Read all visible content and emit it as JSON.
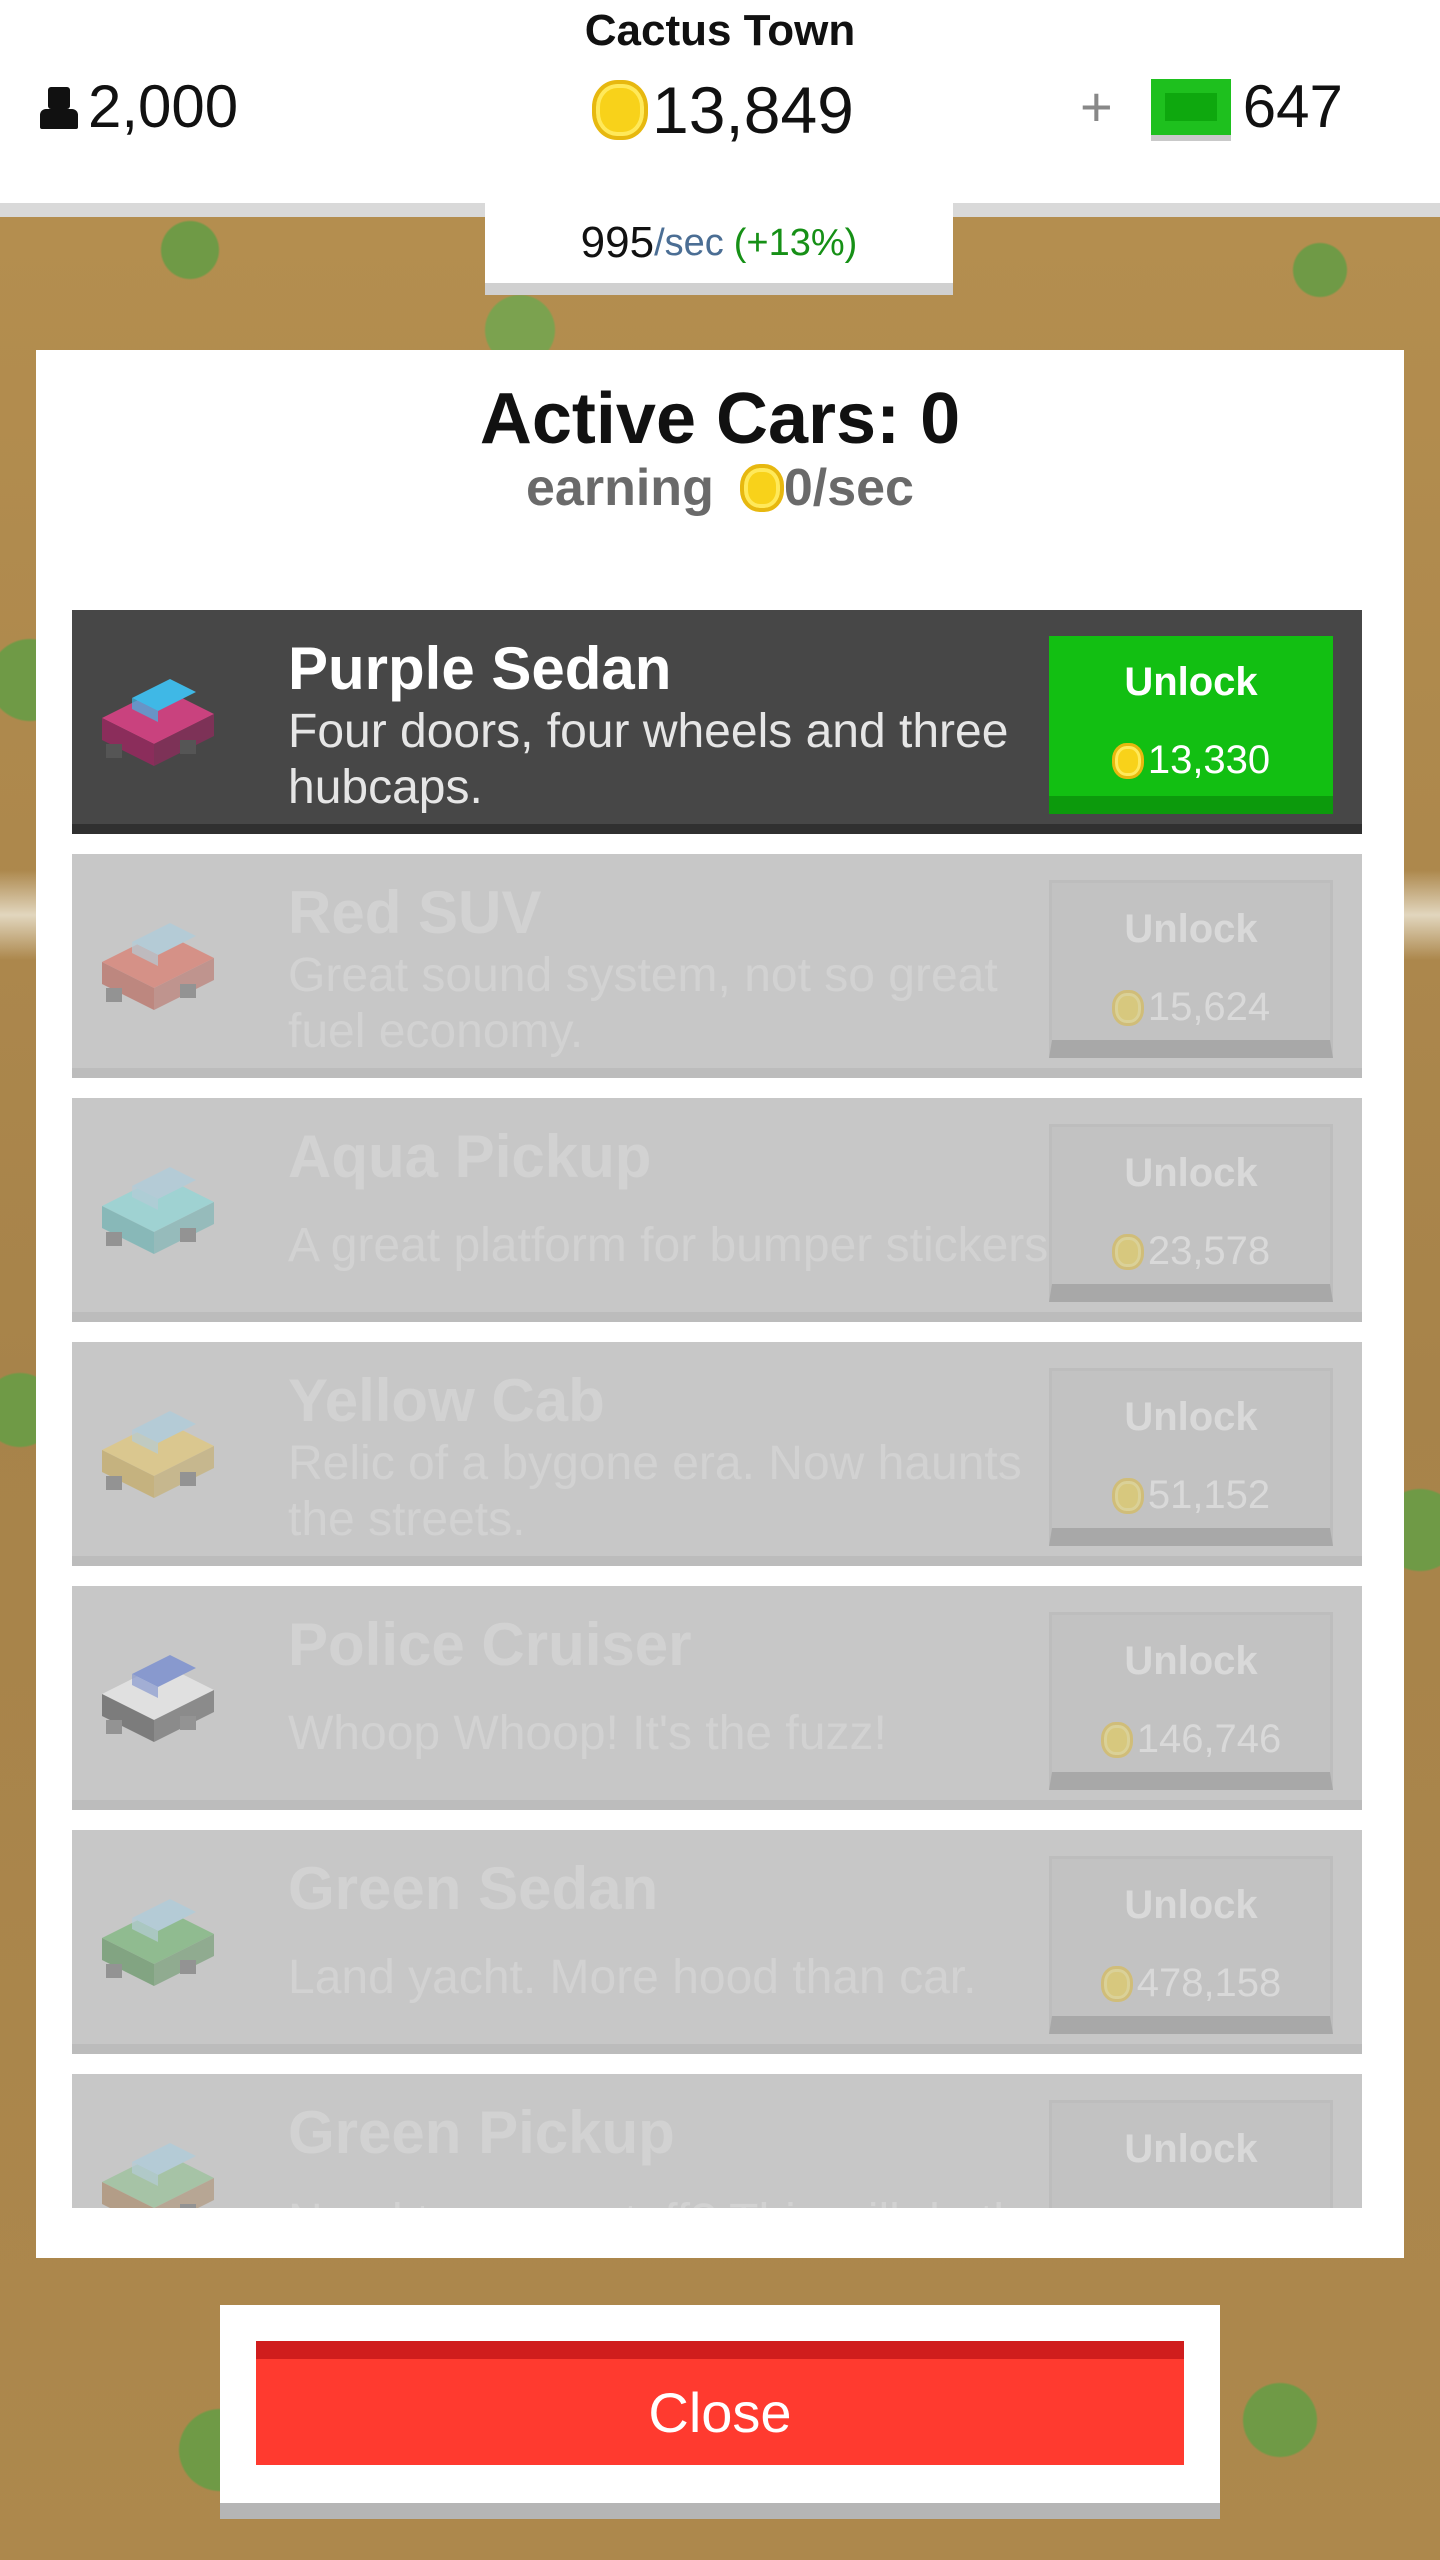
{
  "hud": {
    "town_name": "Cactus Town",
    "population": "2,000",
    "coins": "13,849",
    "cash_plus": "+",
    "cash": "647",
    "rate_value": "995",
    "rate_unit": "/sec",
    "rate_boost": "(+13%)"
  },
  "modal": {
    "title": "Active Cars: 0",
    "earning_label": "earning",
    "earning_value": "0/sec"
  },
  "cars": [
    {
      "name": "Purple Sedan",
      "desc": "Four doors, four wheels and three hubcaps.",
      "button": "Unlock",
      "cost": "13,330",
      "active": true,
      "colors": [
        "#c9427e",
        "#3fb8e6",
        "#8b2d5b"
      ]
    },
    {
      "name": "Red SUV",
      "desc": "Great sound system, not so great fuel economy.",
      "button": "Unlock",
      "cost": "15,624",
      "active": false,
      "colors": [
        "#e8503a",
        "#9fd2ea",
        "#b23a2a"
      ]
    },
    {
      "name": "Aqua Pickup",
      "desc": "A great platform for bumper stickers.",
      "button": "Unlock",
      "cost": "23,578",
      "active": false,
      "colors": [
        "#6fe0e0",
        "#9fd2ea",
        "#3ea6a6"
      ]
    },
    {
      "name": "Yellow Cab",
      "desc": "Relic of a bygone era. Now haunts the streets.",
      "button": "Unlock",
      "cost": "51,152",
      "active": false,
      "colors": [
        "#f2c94c",
        "#9fd2ea",
        "#c49a2a"
      ]
    },
    {
      "name": "Police Cruiser",
      "desc": "Whoop Whoop! It's the fuzz!",
      "button": "Unlock",
      "cost": "146,746",
      "active": false,
      "colors": [
        "#ffffff",
        "#3d63d8",
        "#222222"
      ]
    },
    {
      "name": "Green Sedan",
      "desc": "Land yacht. More hood than car.",
      "button": "Unlock",
      "cost": "478,158",
      "active": false,
      "colors": [
        "#4fae4f",
        "#9fd2ea",
        "#2f7a2f"
      ]
    },
    {
      "name": "Green Pickup",
      "desc": "Need to move stuff? This will do the",
      "button": "Unlock",
      "cost": "",
      "active": false,
      "colors": [
        "#7fbf7f",
        "#9fd2ea",
        "#9b6b3a"
      ]
    }
  ],
  "footer": {
    "close_label": "Close"
  }
}
